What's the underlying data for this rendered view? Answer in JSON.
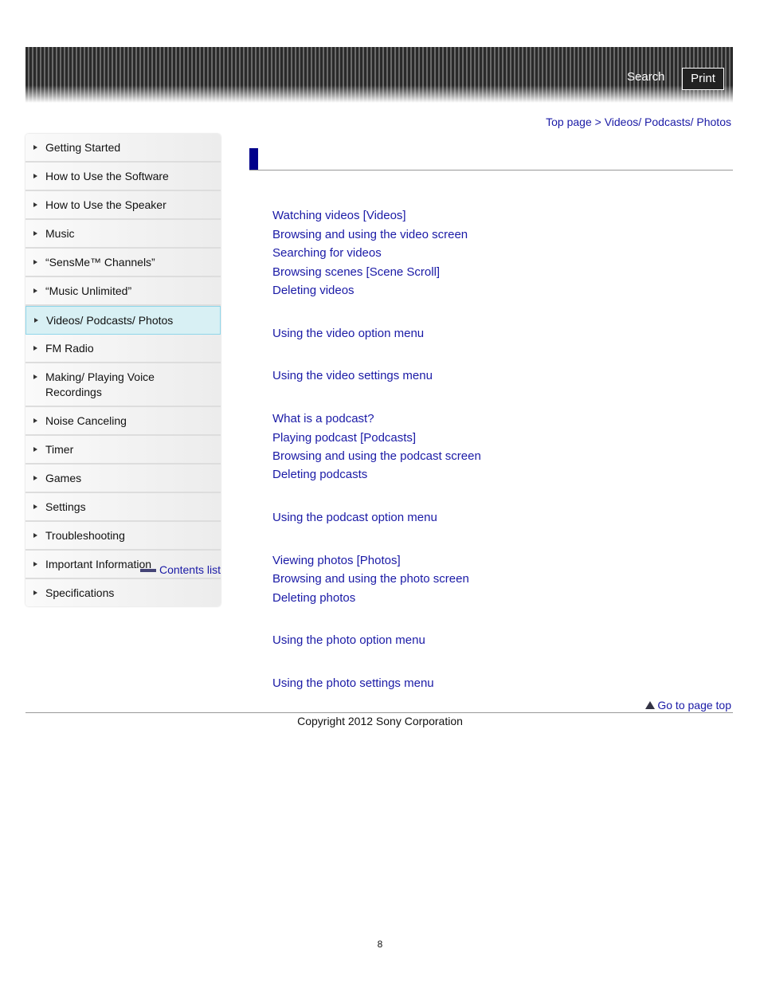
{
  "header": {
    "search_label": "Search",
    "print_label": "Print"
  },
  "breadcrumb": {
    "top": "Top page",
    "separator": " > ",
    "current": "Videos/ Podcasts/ Photos"
  },
  "sidebar": {
    "items": [
      {
        "label": "Getting Started"
      },
      {
        "label": "How to Use the Software"
      },
      {
        "label": "How to Use the Speaker"
      },
      {
        "label": "Music"
      },
      {
        "label": "“SensMe™ Channels”"
      },
      {
        "label": "“Music Unlimited”"
      },
      {
        "label": "Videos/ Podcasts/ Photos",
        "active": true
      },
      {
        "label": "FM Radio"
      },
      {
        "label": "Making/ Playing Voice Recordings"
      },
      {
        "label": "Noise Canceling"
      },
      {
        "label": "Timer"
      },
      {
        "label": "Games"
      },
      {
        "label": "Settings"
      },
      {
        "label": "Troubleshooting"
      },
      {
        "label": "Important Information"
      },
      {
        "label": "Specifications"
      }
    ],
    "contents_list": "Contents list"
  },
  "links": [
    "Watching videos [Videos]",
    "Browsing and using the video screen",
    "Searching for videos",
    "Browsing scenes [Scene Scroll]",
    "Deleting videos",
    "Using the video option menu",
    "Using the video settings menu",
    "What is a podcast?",
    "Playing podcast [Podcasts]",
    "Browsing and using the podcast screen",
    "Deleting podcasts",
    "Using the podcast option menu",
    "Viewing photos [Photos]",
    "Browsing and using the photo screen",
    "Deleting photos",
    "Using the photo option menu",
    "Using the photo settings menu"
  ],
  "footer": {
    "go_top": "Go to page top",
    "copyright": "Copyright 2012 Sony Corporation",
    "page_number": "8"
  },
  "colors": {
    "link": "#1a1aa6",
    "heading_bar": "#00008b",
    "active_item": "#d8f0f4"
  }
}
